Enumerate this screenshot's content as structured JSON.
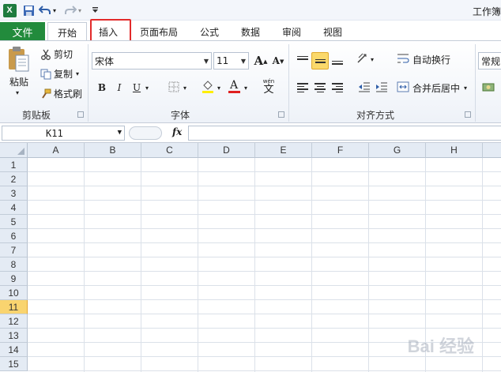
{
  "window": {
    "title": "工作簿"
  },
  "quick_access": {
    "icons": [
      "excel-logo",
      "save-icon",
      "undo-icon",
      "redo-icon",
      "customize-icon"
    ]
  },
  "tabs": {
    "file": "文件",
    "items": [
      {
        "label": "开始",
        "active": true
      },
      {
        "label": "插入",
        "active": false,
        "highlighted": true
      },
      {
        "label": "页面布局",
        "active": false
      },
      {
        "label": "公式",
        "active": false
      },
      {
        "label": "数据",
        "active": false
      },
      {
        "label": "审阅",
        "active": false
      },
      {
        "label": "视图",
        "active": false
      }
    ]
  },
  "ribbon": {
    "clipboard": {
      "paste": "粘贴",
      "cut": "剪切",
      "copy": "复制",
      "format_painter": "格式刷",
      "label": "剪贴板"
    },
    "font": {
      "font_name": "宋体",
      "font_size": "11",
      "bold": "B",
      "italic": "I",
      "underline": "U",
      "grow": "A",
      "shrink": "A",
      "font_color_letter": "A",
      "wen": "wén",
      "wen_char": "文",
      "label": "字体"
    },
    "alignment": {
      "wrap_text": "自动换行",
      "merge_center": "合并后居中",
      "label": "对齐方式"
    },
    "number": {
      "format": "常规"
    }
  },
  "formula_bar": {
    "cell_ref": "K11",
    "fx": "fx",
    "value": ""
  },
  "grid": {
    "columns": [
      "A",
      "B",
      "C",
      "D",
      "E",
      "F",
      "G",
      "H"
    ],
    "rows": [
      "1",
      "2",
      "3",
      "4",
      "5",
      "6",
      "7",
      "8",
      "9",
      "10",
      "11",
      "12",
      "13",
      "14",
      "15"
    ],
    "active_row": "11",
    "active_color": "#f9d46f"
  },
  "watermark": {
    "text": "Bai 经验"
  },
  "colors": {
    "file_tab": "#228b3c",
    "highlight_box": "#e22b2b",
    "header_bg": "#e4ebf4"
  }
}
